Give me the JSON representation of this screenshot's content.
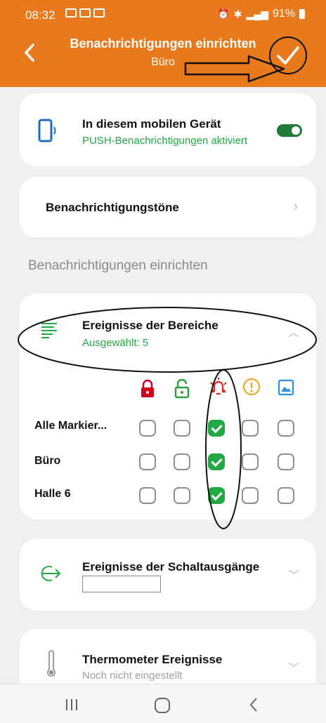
{
  "status_bar": {
    "time": "08:32",
    "battery": "91%"
  },
  "header": {
    "title": "Benachrichtigungen einrichten",
    "subtitle": "Büro"
  },
  "device_card": {
    "title": "In diesem mobilen Gerät",
    "subtitle": "PUSH-Benachrichtigungen aktiviert",
    "toggle_on": true
  },
  "tones_card": {
    "title": "Benachrichtigungstöne"
  },
  "section_heading": "Benachrichtigungen einrichten",
  "areas_card": {
    "title": "Ereignisse der Bereiche",
    "subtitle": "Ausgewählt: 5",
    "columns": [
      {
        "icon": "lock-closed-icon",
        "color": "#d0021b"
      },
      {
        "icon": "lock-open-icon",
        "color": "#2e9e3a"
      },
      {
        "icon": "alarm-bell-icon",
        "color": "#e52222"
      },
      {
        "icon": "warning-icon",
        "color": "#f5a623"
      },
      {
        "icon": "image-icon",
        "color": "#2a8fd6"
      }
    ],
    "rows": [
      {
        "label": "Alle Markier...",
        "checked": [
          false,
          false,
          true,
          false,
          false
        ]
      },
      {
        "label": "Büro",
        "checked": [
          false,
          false,
          true,
          false,
          false
        ]
      },
      {
        "label": "Halle 6",
        "checked": [
          false,
          false,
          true,
          false,
          false
        ]
      }
    ]
  },
  "outputs_card": {
    "title": "Ereignisse der Schaltausgänge"
  },
  "thermo_card": {
    "title": "Thermometer Ereignisse",
    "subtitle": "Noch nicht eingestellt"
  },
  "colors": {
    "accent": "#e8791c",
    "green": "#22a845",
    "dark_green": "#1f7a36"
  }
}
